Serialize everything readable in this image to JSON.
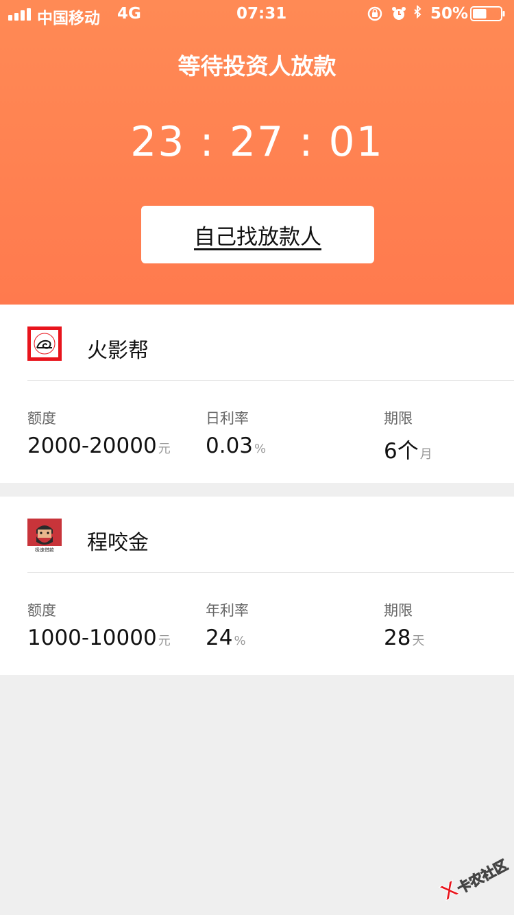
{
  "status_bar": {
    "carrier": "中国移动",
    "network": "4G",
    "time": "07:31",
    "battery_percent": "50%",
    "battery_level": 0.5
  },
  "header": {
    "title": "等待投资人放款",
    "countdown": "23 : 27 : 01",
    "find_lender_label": "自己找放款人"
  },
  "lenders": [
    {
      "name": "火影帮",
      "logo_icon": "leaf-swirl-icon",
      "stats": [
        {
          "label": "额度",
          "value": "2000-20000",
          "unit": "元"
        },
        {
          "label": "日利率",
          "value": "0.03",
          "unit": "%"
        },
        {
          "label": "期限",
          "value": "6个",
          "unit": "月"
        }
      ]
    },
    {
      "name": "程咬金",
      "logo_icon": "bearded-man-avatar-icon",
      "logo_caption": "极速借款",
      "stats": [
        {
          "label": "额度",
          "value": "1000-10000",
          "unit": "元"
        },
        {
          "label": "年利率",
          "value": "24",
          "unit": "%"
        },
        {
          "label": "期限",
          "value": "28",
          "unit": "天"
        }
      ]
    }
  ],
  "watermark": {
    "text": "卡农社区"
  },
  "colors": {
    "header_gradient_top": "#ff8a55",
    "header_gradient_bottom": "#ff7a4e",
    "background": "#efefef"
  }
}
